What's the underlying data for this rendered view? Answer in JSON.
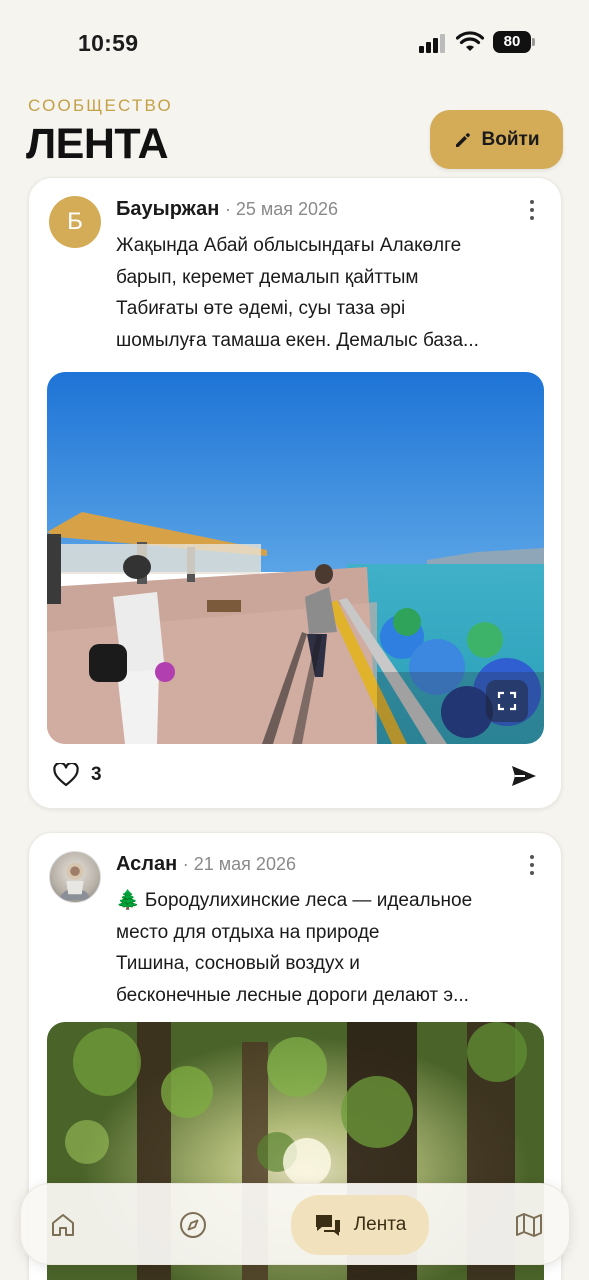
{
  "status_bar": {
    "time": "10:59",
    "battery": "80"
  },
  "header": {
    "kicker": "СООБЩЕСТВО",
    "title": "ЛЕНТА",
    "login_label": "Войти"
  },
  "posts": [
    {
      "avatar_letter": "Б",
      "author": "Бауыржан",
      "date": "· 25 мая 2026",
      "lines": [
        "Жақында Абай облысындағы Алакөлге",
        "барып, керемет демалып қайттым",
        "Табиғаты өте әдемі, суы таза әрі",
        "шомылуға тамаша екен. Демалыс база..."
      ],
      "likes": "3"
    },
    {
      "author": "Аслан",
      "date": "· 21 мая 2026",
      "lines": [
        "🌲 Бородулихинские леса — идеальное",
        "место для отдыха на природе",
        "Тишина, сосновый воздух и",
        "бесконечные лесные дороги делают э..."
      ]
    }
  ],
  "nav": {
    "active_label": "Лента"
  },
  "colors": {
    "accent": "#d4ac58",
    "kicker": "#c4a047",
    "nav_active_bg": "#f1e2bd"
  },
  "icons": [
    "pencil-icon",
    "more-vertical-icon",
    "heart-icon",
    "send-icon",
    "expand-icon",
    "home-icon",
    "compass-icon",
    "chat-icon",
    "map-icon"
  ]
}
